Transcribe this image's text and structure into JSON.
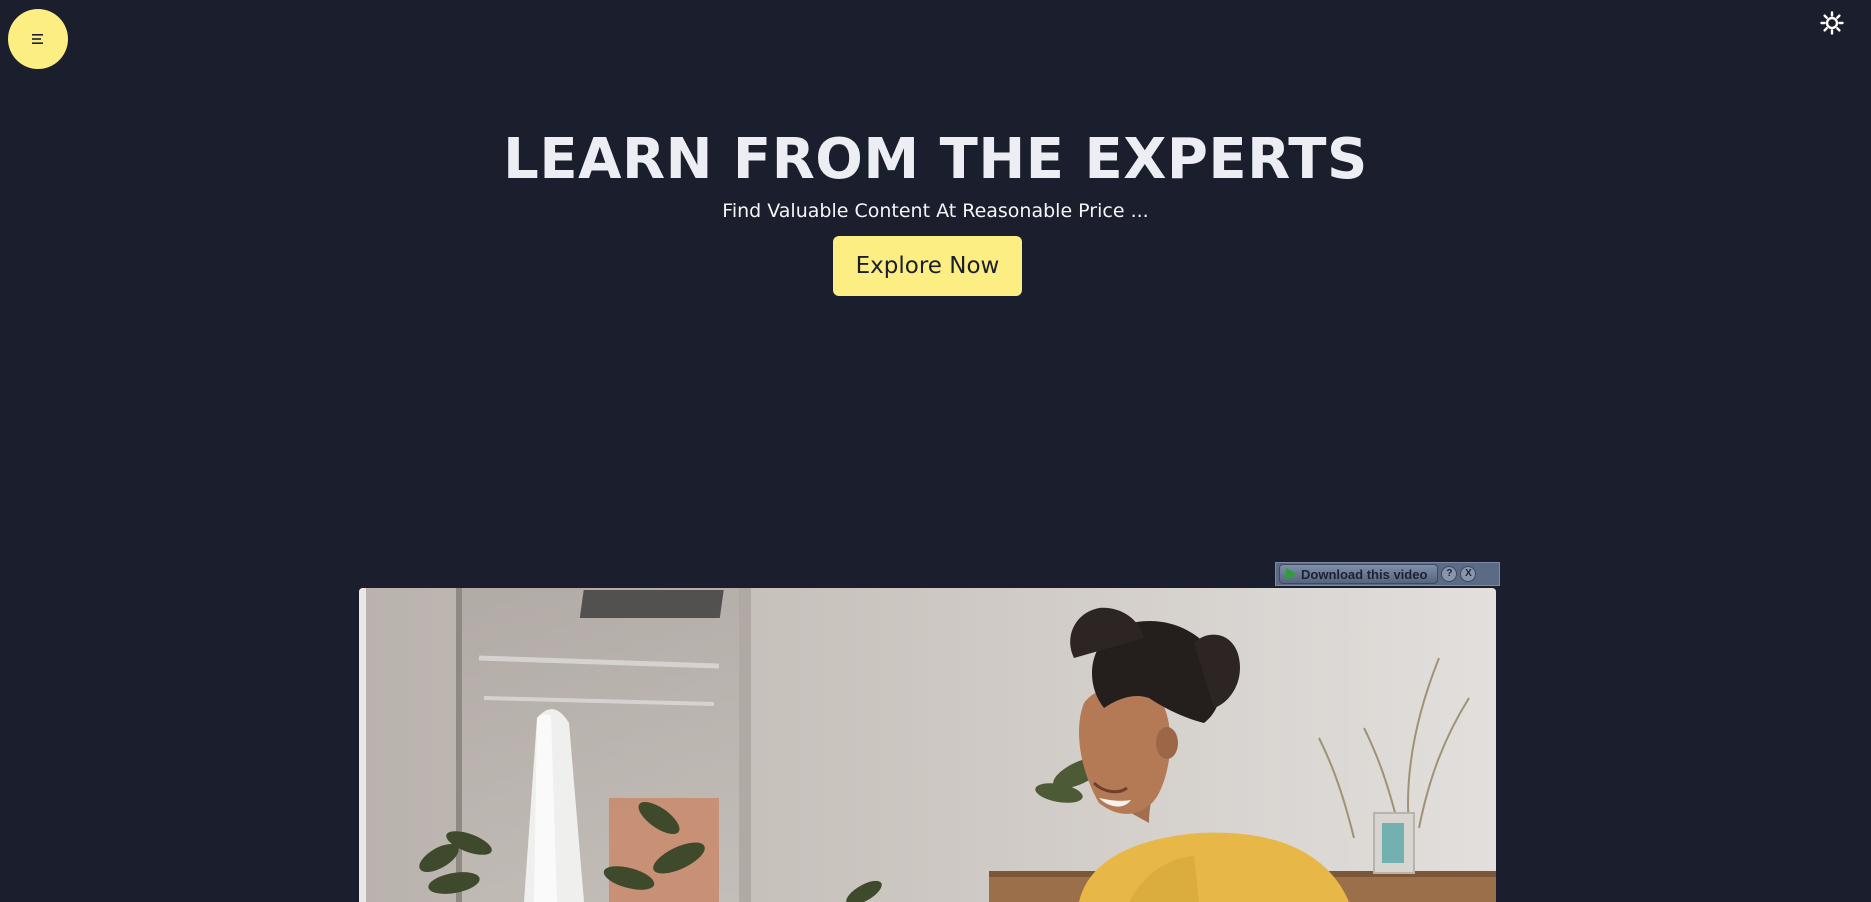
{
  "hero": {
    "title": "LEARN FROM THE EXPERTS",
    "subtitle": "Find Valuable Content At Reasonable Price ...",
    "cta_label": "Explore Now"
  },
  "nav": {
    "menu_icon": "hamburger-menu-icon",
    "theme_icon": "sun-icon"
  },
  "video_overlay": {
    "download_label": "Download this video",
    "help_label": "?",
    "close_label": "X"
  },
  "colors": {
    "background": "#1b1f2d",
    "accent": "#fcee83",
    "text": "#eceef3"
  }
}
